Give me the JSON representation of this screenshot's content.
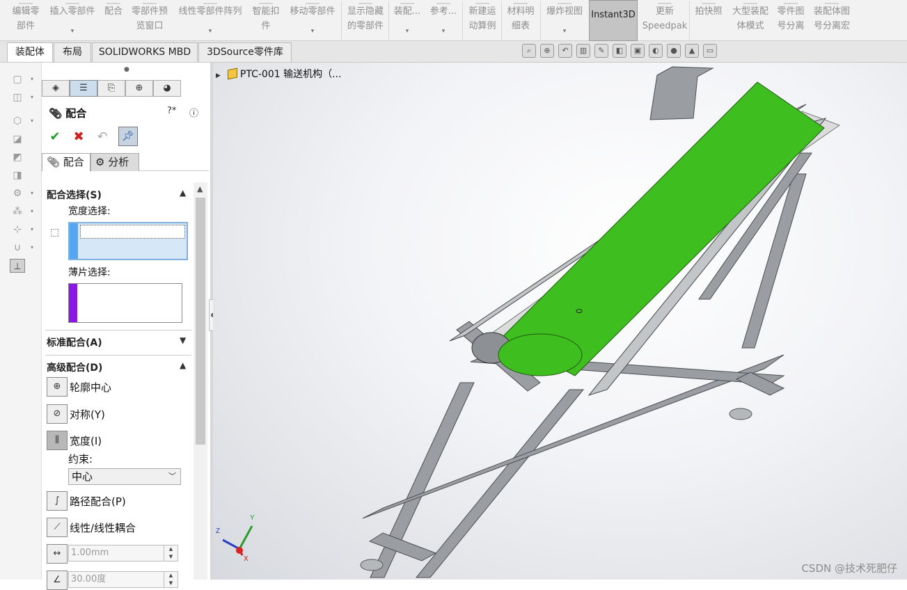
{
  "toolbar": {
    "items": [
      {
        "line1": "编辑零",
        "line2": "部件"
      },
      {
        "line1": "插入零部件",
        "line2": ""
      },
      {
        "line1": "配合",
        "line2": ""
      },
      {
        "line1": "零部件预",
        "line2": "览窗口"
      },
      {
        "line1": "线性零部件阵列",
        "line2": ""
      },
      {
        "line1": "智能扣",
        "line2": "件"
      },
      {
        "line1": "移动零部件",
        "line2": ""
      },
      {
        "line1": "显示隐藏",
        "line2": "的零部件"
      },
      {
        "line1": "装配...",
        "line2": ""
      },
      {
        "line1": "参考...",
        "line2": ""
      },
      {
        "line1": "新建运",
        "line2": "动算例"
      },
      {
        "line1": "材料明",
        "line2": "细表"
      },
      {
        "line1": "爆炸视图",
        "line2": ""
      },
      {
        "line1": "Instant3D",
        "line2": ""
      },
      {
        "line1": "更新",
        "line2": "Speedpak"
      },
      {
        "line1": "拍快照",
        "line2": ""
      },
      {
        "line1": "大型装配",
        "line2": "体模式"
      },
      {
        "line1": "零件图",
        "line2": "号分离"
      },
      {
        "line1": "装配体图",
        "line2": "号分离宏"
      }
    ]
  },
  "tabs": [
    "装配体",
    "布局",
    "SOLIDWORKS MBD",
    "3DSource零件库"
  ],
  "panel": {
    "title": "配合",
    "subtabs": {
      "mates": "配合",
      "analysis": "分析"
    },
    "mate_selection": {
      "header": "配合选择(S)",
      "width_label": "宽度选择:",
      "tab_label": "薄片选择:",
      "width_color": "#55a6f0",
      "tab_color": "#8a19e6"
    },
    "standard_header": "标准配合(A)",
    "advanced": {
      "header": "高级配合(D)",
      "profile_center": "轮廓中心",
      "symmetric": "对称(Y)",
      "width": "宽度(I)",
      "constraint_label": "约束:",
      "constraint_value": "中心",
      "path_mate": "路径配合(P)",
      "linear_coupler": "线性/线性耦合",
      "distance_value": "1.00mm",
      "angle_value": "30.00度"
    }
  },
  "viewport": {
    "tree_root": "PTC-001 输送机构（...",
    "watermark": "CSDN @技术死肥仔",
    "belt_color": "#3fbf1f",
    "frame_color": "#9a9ea3",
    "axis_labels": {
      "x": "X",
      "y": "Y",
      "z": "Z"
    }
  }
}
